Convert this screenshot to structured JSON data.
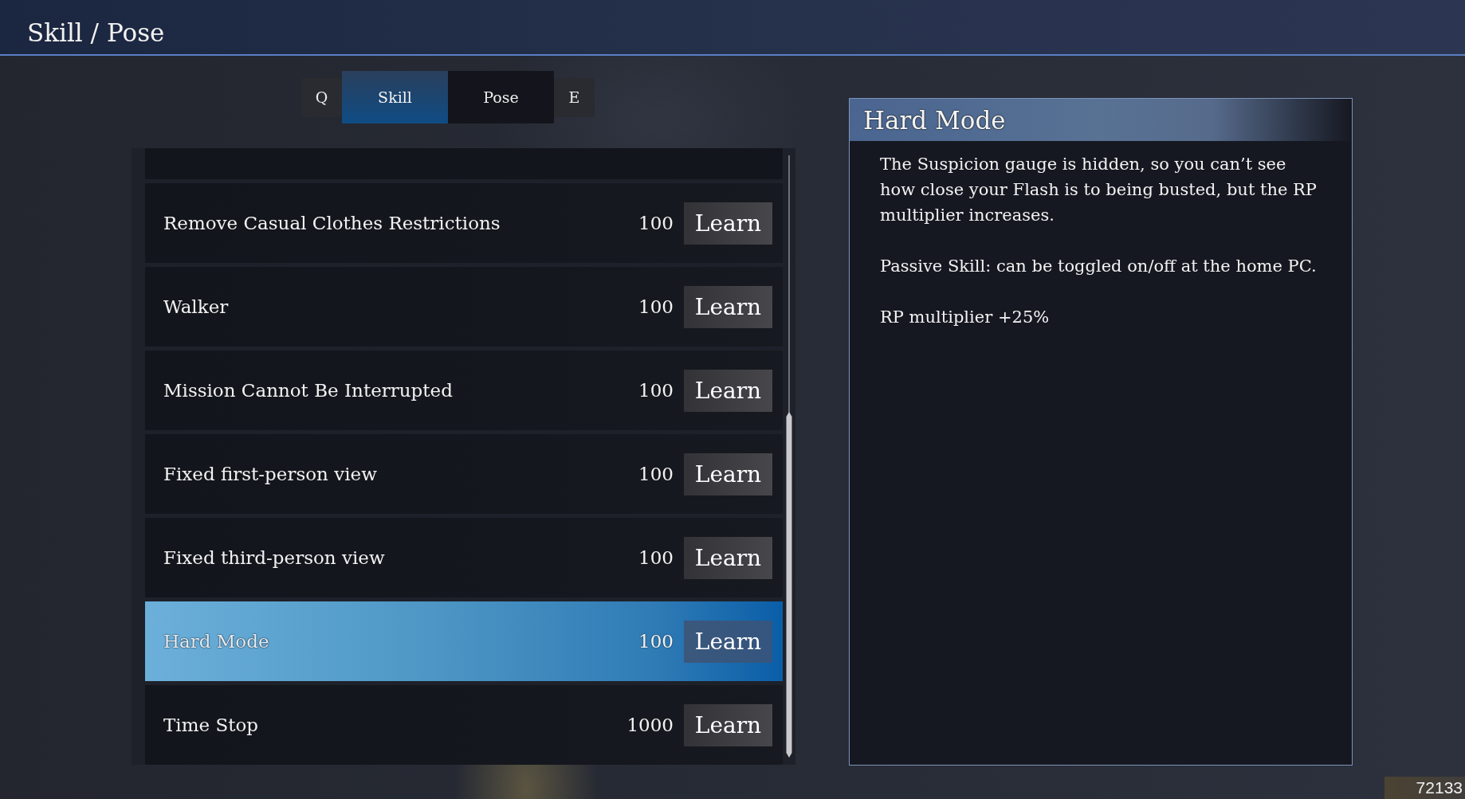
{
  "header": {
    "title": "Skill / Pose"
  },
  "tab_bar": {
    "prev_key": "Q",
    "tabs": [
      {
        "label": "Skill",
        "selected": true
      },
      {
        "label": "Pose",
        "selected": false
      }
    ],
    "next_key": "E"
  },
  "skill_list": {
    "items": [
      {
        "name": "Remove Casual Clothes Restrictions",
        "cost": "100",
        "action": "Learn",
        "selected": false
      },
      {
        "name": "Walker",
        "cost": "100",
        "action": "Learn",
        "selected": false
      },
      {
        "name": "Mission Cannot Be Interrupted",
        "cost": "100",
        "action": "Learn",
        "selected": false
      },
      {
        "name": "Fixed first-person view",
        "cost": "100",
        "action": "Learn",
        "selected": false
      },
      {
        "name": "Fixed third-person view",
        "cost": "100",
        "action": "Learn",
        "selected": false
      },
      {
        "name": "Hard Mode",
        "cost": "100",
        "action": "Learn",
        "selected": true
      },
      {
        "name": "Time Stop",
        "cost": "1000",
        "action": "Learn",
        "selected": false
      }
    ]
  },
  "detail_panel": {
    "title": "Hard Mode",
    "paragraphs": [
      "The Suspicion gauge is hidden, so you can’t see how close your Flash is to being busted, but the RP multiplier increases.",
      "Passive Skill: can be toggled on/off at the home PC.",
      "RP multiplier +25%"
    ]
  },
  "currency": {
    "amount": "72133"
  }
}
